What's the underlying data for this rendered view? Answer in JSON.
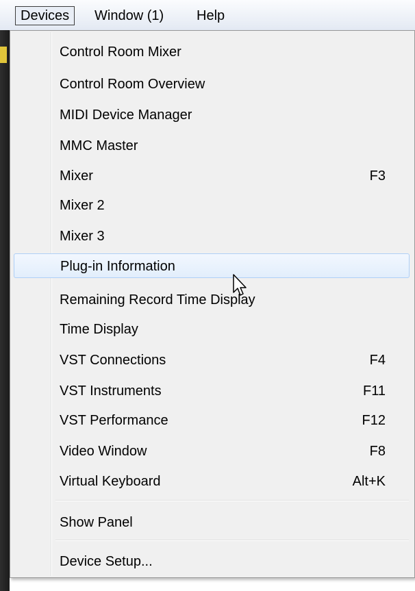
{
  "menubar": {
    "items": [
      {
        "label": "Devices"
      },
      {
        "label": "Window (1)"
      },
      {
        "label": "Help"
      }
    ]
  },
  "menu": {
    "items": [
      {
        "label": "Control Room Mixer",
        "shortcut": ""
      },
      {
        "label": "Control Room Overview",
        "shortcut": ""
      },
      {
        "label": "MIDI Device Manager",
        "shortcut": ""
      },
      {
        "label": "MMC Master",
        "shortcut": ""
      },
      {
        "label": "Mixer",
        "shortcut": "F3"
      },
      {
        "label": "Mixer 2",
        "shortcut": ""
      },
      {
        "label": "Mixer 3",
        "shortcut": ""
      },
      {
        "label": "Plug-in Information",
        "shortcut": ""
      },
      {
        "label": "Remaining Record Time Display",
        "shortcut": ""
      },
      {
        "label": "Time Display",
        "shortcut": ""
      },
      {
        "label": "VST Connections",
        "shortcut": "F4"
      },
      {
        "label": "VST Instruments",
        "shortcut": "F11"
      },
      {
        "label": "VST Performance",
        "shortcut": "F12"
      },
      {
        "label": "Video Window",
        "shortcut": "F8"
      },
      {
        "label": "Virtual Keyboard",
        "shortcut": "Alt+K"
      },
      {
        "label": "Show Panel",
        "shortcut": ""
      },
      {
        "label": "Device Setup...",
        "shortcut": ""
      }
    ],
    "highlighted_item": "Plug-in Information"
  },
  "colors": {
    "menu_background": "#f0f0f0",
    "highlight_border": "#aecff7",
    "highlight_fill": "#e2eefc"
  }
}
